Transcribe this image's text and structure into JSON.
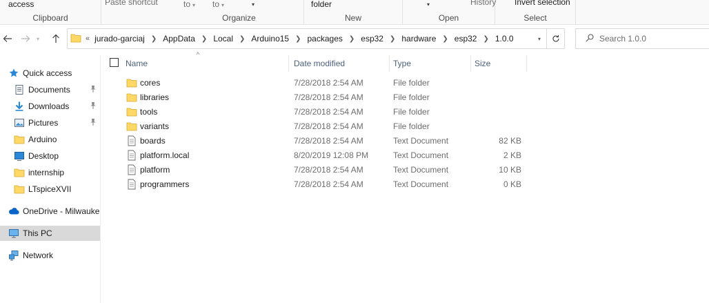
{
  "ribbon": {
    "clipboard": {
      "label": "Clipboard",
      "access_text": "access",
      "paste_shortcut": "Paste shortcut"
    },
    "organize": {
      "label": "Organize",
      "move_to": "to",
      "copy_to": "to"
    },
    "new": {
      "label": "New",
      "new_folder_text": "folder"
    },
    "open": {
      "label": "Open",
      "history": "History"
    },
    "select": {
      "label": "Select",
      "invert_selection": "Invert selection"
    }
  },
  "address": {
    "crumbs": [
      "jurado-garciaj",
      "AppData",
      "Local",
      "Arduino15",
      "packages",
      "esp32",
      "hardware",
      "esp32",
      "1.0.0"
    ]
  },
  "search": {
    "placeholder": "Search 1.0.0"
  },
  "nav": {
    "items": [
      {
        "label": "Quick access",
        "icon": "star-icon"
      },
      {
        "label": "Documents",
        "icon": "documents-icon",
        "pinned": true
      },
      {
        "label": "Downloads",
        "icon": "download-icon",
        "pinned": true
      },
      {
        "label": "Pictures",
        "icon": "pictures-icon",
        "pinned": true
      },
      {
        "label": "Arduino",
        "icon": "folder-icon"
      },
      {
        "label": "Desktop",
        "icon": "desktop-icon"
      },
      {
        "label": "internship",
        "icon": "folder-icon"
      },
      {
        "label": "LTspiceXVII",
        "icon": "folder-icon"
      },
      {
        "label": "OneDrive - Milwauke",
        "icon": "cloud-icon"
      },
      {
        "label": "This PC",
        "icon": "computer-icon"
      },
      {
        "label": "Network",
        "icon": "network-icon"
      }
    ]
  },
  "columns": {
    "name": "Name",
    "date": "Date modified",
    "type": "Type",
    "size": "Size"
  },
  "files": [
    {
      "name": "cores",
      "date": "7/28/2018 2:54 AM",
      "type": "File folder",
      "size": "",
      "kind": "folder"
    },
    {
      "name": "libraries",
      "date": "7/28/2018 2:54 AM",
      "type": "File folder",
      "size": "",
      "kind": "folder"
    },
    {
      "name": "tools",
      "date": "7/28/2018 2:54 AM",
      "type": "File folder",
      "size": "",
      "kind": "folder"
    },
    {
      "name": "variants",
      "date": "7/28/2018 2:54 AM",
      "type": "File folder",
      "size": "",
      "kind": "folder"
    },
    {
      "name": "boards",
      "date": "7/28/2018 2:54 AM",
      "type": "Text Document",
      "size": "82 KB",
      "kind": "text"
    },
    {
      "name": "platform.local",
      "date": "8/20/2019 12:08 PM",
      "type": "Text Document",
      "size": "2 KB",
      "kind": "text"
    },
    {
      "name": "platform",
      "date": "7/28/2018 2:54 AM",
      "type": "Text Document",
      "size": "10 KB",
      "kind": "text"
    },
    {
      "name": "programmers",
      "date": "7/28/2018 2:54 AM",
      "type": "Text Document",
      "size": "0 KB",
      "kind": "text"
    }
  ],
  "colors": {
    "folder": "#ffd867",
    "accent": "#0078d7",
    "selected_bg": "#d9d9d9",
    "header_text": "#4c607a"
  }
}
